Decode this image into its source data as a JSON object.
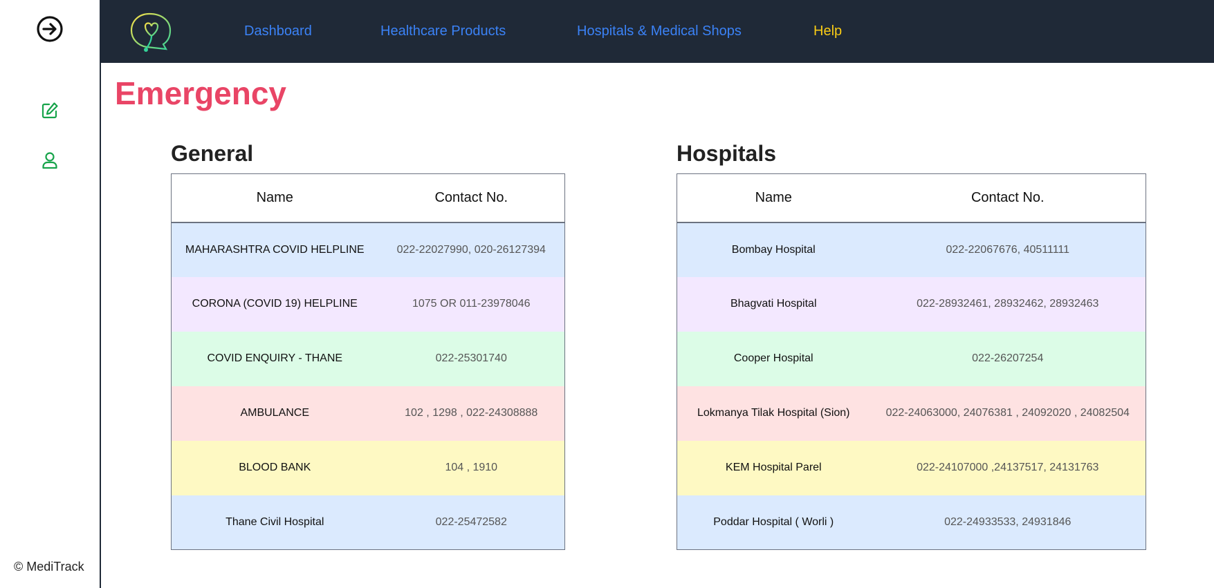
{
  "app": {
    "copyright": "© MediTrack"
  },
  "nav": {
    "dashboard": "Dashboard",
    "healthcare_products": "Healthcare Products",
    "hospitals_shops": "Hospitals & Medical Shops",
    "help": "Help"
  },
  "colors": {
    "nav_link": "#3b82f6",
    "help_link": "#facc15",
    "title": "#e94566",
    "topbar": "#1f2937",
    "sidebar_icons": "#16a34a"
  },
  "page": {
    "title": "Emergency"
  },
  "general": {
    "title": "General",
    "columns": [
      "Name",
      "Contact No."
    ],
    "rows": [
      {
        "name": "MAHARASHTRA COVID HELPLINE",
        "contact": "022-22027990, 020-26127394"
      },
      {
        "name": "CORONA (COVID 19) HELPLINE",
        "contact": "1075 OR 011-23978046"
      },
      {
        "name": "COVID ENQUIRY - THANE",
        "contact": "022-25301740"
      },
      {
        "name": "AMBULANCE",
        "contact": "102 , 1298 , 022-24308888"
      },
      {
        "name": "BLOOD BANK",
        "contact": "104 , 1910"
      },
      {
        "name": "Thane Civil Hospital",
        "contact": "022-25472582"
      }
    ]
  },
  "hospitals": {
    "title": "Hospitals",
    "columns": [
      "Name",
      "Contact No."
    ],
    "rows": [
      {
        "name": "Bombay Hospital",
        "contact": "022-22067676, 40511111"
      },
      {
        "name": "Bhagvati Hospital",
        "contact": "022-28932461, 28932462, 28932463"
      },
      {
        "name": "Cooper Hospital",
        "contact": "022-26207254"
      },
      {
        "name": "Lokmanya Tilak Hospital (Sion)",
        "contact": "022-24063000, 24076381 , 24092020 , 24082504"
      },
      {
        "name": "KEM Hospital Parel",
        "contact": "022-24107000 ,24137517, 24131763"
      },
      {
        "name": "Poddar Hospital ( Worli )",
        "contact": "022-24933533, 24931846"
      }
    ]
  }
}
